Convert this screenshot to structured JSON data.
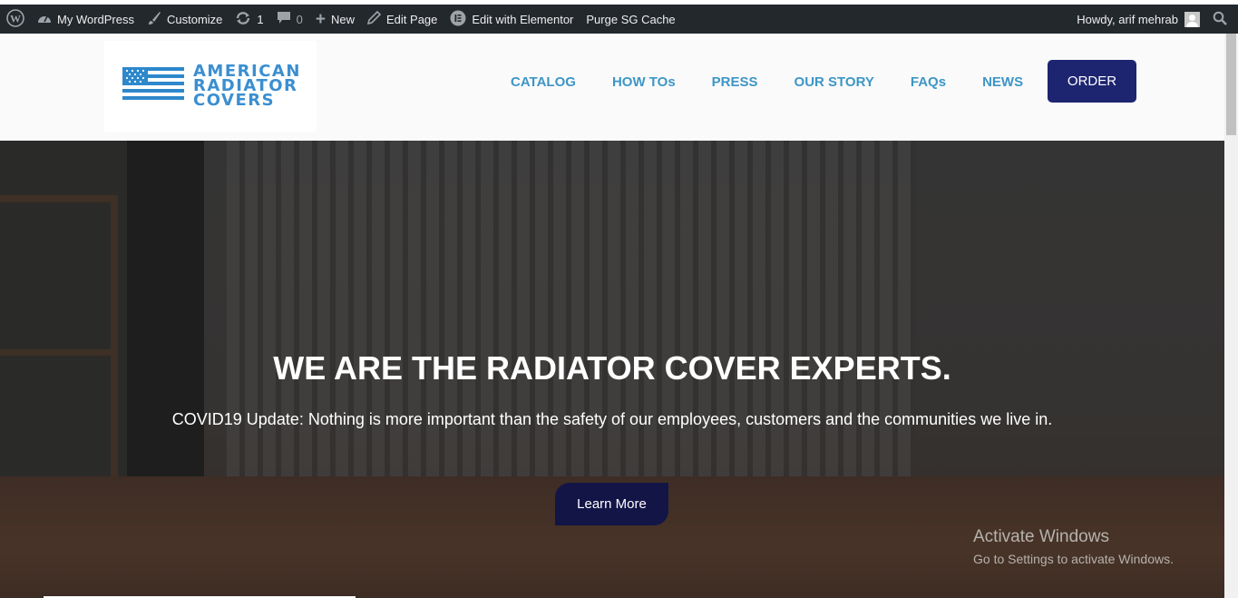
{
  "adminbar": {
    "site_name": "My WordPress",
    "customize": "Customize",
    "updates_count": "1",
    "comments_count": "0",
    "new_label": "New",
    "edit_page": "Edit Page",
    "edit_elementor": "Edit with Elementor",
    "purge_cache": "Purge SG Cache",
    "howdy": "Howdy, arif mehrab"
  },
  "header": {
    "logo": [
      "AMERICAN",
      "RADIATOR",
      "COVERS"
    ],
    "nav": [
      "CATALOG",
      "HOW TOs",
      "PRESS",
      "OUR STORY",
      "FAQs",
      "NEWS"
    ],
    "order_label": "ORDER"
  },
  "hero": {
    "title": "WE ARE THE RADIATOR COVER EXPERTS.",
    "text": "COVID19 Update: Nothing is more important than the safety of our employees, customers and the communities we live in.",
    "button": "Learn More"
  },
  "watermark": {
    "line1": "Activate Windows",
    "line2": "Go to Settings to activate Windows."
  },
  "colors": {
    "adminbar_bg": "#23282d",
    "nav_text": "#3d96c7",
    "order_bg": "#1d2570",
    "learn_bg": "#131547",
    "logo_blue": "#3b8fd0"
  }
}
